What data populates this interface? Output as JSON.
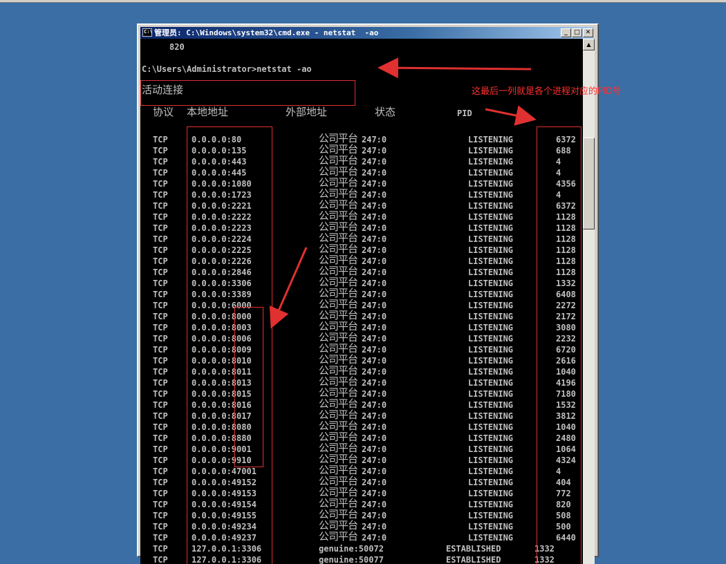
{
  "window": {
    "title": "管理员: C:\\Windows\\system32\\cmd.exe - netstat  -ao",
    "icon_label": "C:\\",
    "buttons": {
      "minimize": "_",
      "maximize": "□",
      "close": "✕"
    }
  },
  "console": {
    "prev_output": "820",
    "prompt": "C:\\Users\\Administrator>netstat -ao",
    "section_title": "活动连接",
    "headers": {
      "proto": "协议",
      "local": "本地地址",
      "remote": "外部地址",
      "state": "状态",
      "pid": "PID"
    },
    "rows": [
      {
        "proto": "TCP",
        "local": "0.0.0.0:80",
        "remote_cjk": "公司平台",
        "remote_tail": "247:0",
        "state": "LISTENING",
        "pid": "6372"
      },
      {
        "proto": "TCP",
        "local": "0.0.0.0:135",
        "remote_cjk": "公司平台",
        "remote_tail": "247:0",
        "state": "LISTENING",
        "pid": "688"
      },
      {
        "proto": "TCP",
        "local": "0.0.0.0:443",
        "remote_cjk": "公司平台",
        "remote_tail": "247:0",
        "state": "LISTENING",
        "pid": "4"
      },
      {
        "proto": "TCP",
        "local": "0.0.0.0:445",
        "remote_cjk": "公司平台",
        "remote_tail": "247:0",
        "state": "LISTENING",
        "pid": "4"
      },
      {
        "proto": "TCP",
        "local": "0.0.0.0:1080",
        "remote_cjk": "公司平台",
        "remote_tail": "247:0",
        "state": "LISTENING",
        "pid": "4356"
      },
      {
        "proto": "TCP",
        "local": "0.0.0.0:1723",
        "remote_cjk": "公司平台",
        "remote_tail": "247:0",
        "state": "LISTENING",
        "pid": "4"
      },
      {
        "proto": "TCP",
        "local": "0.0.0.0:2221",
        "remote_cjk": "公司平台",
        "remote_tail": "247:0",
        "state": "LISTENING",
        "pid": "6372"
      },
      {
        "proto": "TCP",
        "local": "0.0.0.0:2222",
        "remote_cjk": "公司平台",
        "remote_tail": "247:0",
        "state": "LISTENING",
        "pid": "1128"
      },
      {
        "proto": "TCP",
        "local": "0.0.0.0:2223",
        "remote_cjk": "公司平台",
        "remote_tail": "247:0",
        "state": "LISTENING",
        "pid": "1128"
      },
      {
        "proto": "TCP",
        "local": "0.0.0.0:2224",
        "remote_cjk": "公司平台",
        "remote_tail": "247:0",
        "state": "LISTENING",
        "pid": "1128"
      },
      {
        "proto": "TCP",
        "local": "0.0.0.0:2225",
        "remote_cjk": "公司平台",
        "remote_tail": "247:0",
        "state": "LISTENING",
        "pid": "1128"
      },
      {
        "proto": "TCP",
        "local": "0.0.0.0:2226",
        "remote_cjk": "公司平台",
        "remote_tail": "247:0",
        "state": "LISTENING",
        "pid": "1128"
      },
      {
        "proto": "TCP",
        "local": "0.0.0.0:2846",
        "remote_cjk": "公司平台",
        "remote_tail": "247:0",
        "state": "LISTENING",
        "pid": "1128"
      },
      {
        "proto": "TCP",
        "local": "0.0.0.0:3306",
        "remote_cjk": "公司平台",
        "remote_tail": "247:0",
        "state": "LISTENING",
        "pid": "1332"
      },
      {
        "proto": "TCP",
        "local": "0.0.0.0:3389",
        "remote_cjk": "公司平台",
        "remote_tail": "247:0",
        "state": "LISTENING",
        "pid": "6408"
      },
      {
        "proto": "TCP",
        "local": "0.0.0.0:6000",
        "remote_cjk": "公司平台",
        "remote_tail": "247:0",
        "state": "LISTENING",
        "pid": "2272"
      },
      {
        "proto": "TCP",
        "local": "0.0.0.0:8000",
        "remote_cjk": "公司平台",
        "remote_tail": "247:0",
        "state": "LISTENING",
        "pid": "2172"
      },
      {
        "proto": "TCP",
        "local": "0.0.0.0:8003",
        "remote_cjk": "公司平台",
        "remote_tail": "247:0",
        "state": "LISTENING",
        "pid": "3080"
      },
      {
        "proto": "TCP",
        "local": "0.0.0.0:8006",
        "remote_cjk": "公司平台",
        "remote_tail": "247:0",
        "state": "LISTENING",
        "pid": "2232"
      },
      {
        "proto": "TCP",
        "local": "0.0.0.0:8009",
        "remote_cjk": "公司平台",
        "remote_tail": "247:0",
        "state": "LISTENING",
        "pid": "6720"
      },
      {
        "proto": "TCP",
        "local": "0.0.0.0:8010",
        "remote_cjk": "公司平台",
        "remote_tail": "247:0",
        "state": "LISTENING",
        "pid": "2616"
      },
      {
        "proto": "TCP",
        "local": "0.0.0.0:8011",
        "remote_cjk": "公司平台",
        "remote_tail": "247:0",
        "state": "LISTENING",
        "pid": "1040"
      },
      {
        "proto": "TCP",
        "local": "0.0.0.0:8013",
        "remote_cjk": "公司平台",
        "remote_tail": "247:0",
        "state": "LISTENING",
        "pid": "4196"
      },
      {
        "proto": "TCP",
        "local": "0.0.0.0:8015",
        "remote_cjk": "公司平台",
        "remote_tail": "247:0",
        "state": "LISTENING",
        "pid": "7180"
      },
      {
        "proto": "TCP",
        "local": "0.0.0.0:8016",
        "remote_cjk": "公司平台",
        "remote_tail": "247:0",
        "state": "LISTENING",
        "pid": "1532"
      },
      {
        "proto": "TCP",
        "local": "0.0.0.0:8017",
        "remote_cjk": "公司平台",
        "remote_tail": "247:0",
        "state": "LISTENING",
        "pid": "3812"
      },
      {
        "proto": "TCP",
        "local": "0.0.0.0:8080",
        "remote_cjk": "公司平台",
        "remote_tail": "247:0",
        "state": "LISTENING",
        "pid": "1040"
      },
      {
        "proto": "TCP",
        "local": "0.0.0.0:8880",
        "remote_cjk": "公司平台",
        "remote_tail": "247:0",
        "state": "LISTENING",
        "pid": "2480"
      },
      {
        "proto": "TCP",
        "local": "0.0.0.0:9001",
        "remote_cjk": "公司平台",
        "remote_tail": "247:0",
        "state": "LISTENING",
        "pid": "1064"
      },
      {
        "proto": "TCP",
        "local": "0.0.0.0:9910",
        "remote_cjk": "公司平台",
        "remote_tail": "247:0",
        "state": "LISTENING",
        "pid": "4324"
      },
      {
        "proto": "TCP",
        "local": "0.0.0.0:47001",
        "remote_cjk": "公司平台",
        "remote_tail": "247:0",
        "state": "LISTENING",
        "pid": "4"
      },
      {
        "proto": "TCP",
        "local": "0.0.0.0:49152",
        "remote_cjk": "公司平台",
        "remote_tail": "247:0",
        "state": "LISTENING",
        "pid": "404"
      },
      {
        "proto": "TCP",
        "local": "0.0.0.0:49153",
        "remote_cjk": "公司平台",
        "remote_tail": "247:0",
        "state": "LISTENING",
        "pid": "772"
      },
      {
        "proto": "TCP",
        "local": "0.0.0.0:49154",
        "remote_cjk": "公司平台",
        "remote_tail": "247:0",
        "state": "LISTENING",
        "pid": "820"
      },
      {
        "proto": "TCP",
        "local": "0.0.0.0:49155",
        "remote_cjk": "公司平台",
        "remote_tail": "247:0",
        "state": "LISTENING",
        "pid": "508"
      },
      {
        "proto": "TCP",
        "local": "0.0.0.0:49234",
        "remote_cjk": "公司平台",
        "remote_tail": "247:0",
        "state": "LISTENING",
        "pid": "500"
      },
      {
        "proto": "TCP",
        "local": "0.0.0.0:49237",
        "remote_cjk": "公司平台",
        "remote_tail": "247:0",
        "state": "LISTENING",
        "pid": "6440"
      },
      {
        "proto": "TCP",
        "local": "127.0.0.1:3306",
        "remote_cjk": "",
        "remote_tail": "genuine:50072",
        "state": "ESTABLISHED",
        "pid": "1332"
      },
      {
        "proto": "TCP",
        "local": "127.0.0.1:3306",
        "remote_cjk": "",
        "remote_tail": "genuine:50077",
        "state": "ESTABLISHED",
        "pid": "1332"
      }
    ]
  },
  "annotation": {
    "note": "这最后一列就是各个进程对应的PID号",
    "color": "#e03030"
  }
}
